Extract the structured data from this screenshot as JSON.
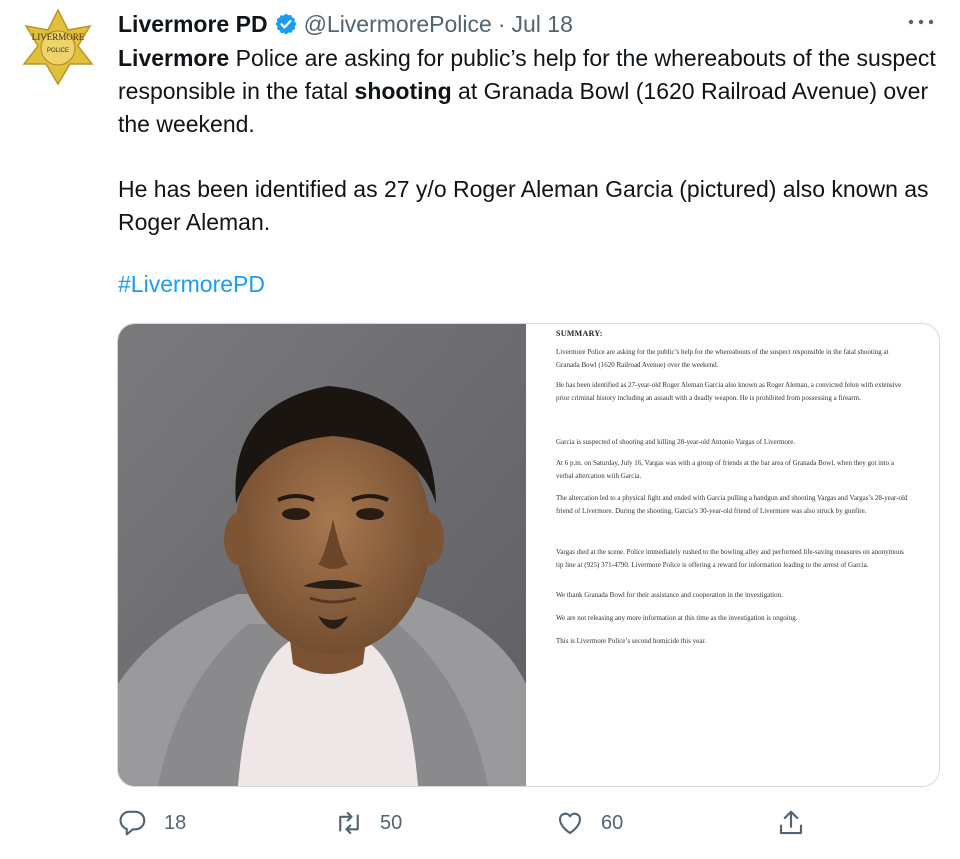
{
  "author": {
    "name": "Livermore PD",
    "handle": "@LivermorePolice",
    "separator": "·",
    "date": "Jul 18",
    "badge_top": "LIVERMORE",
    "badge_mid": "POLICE",
    "badge_color": "#e2c13a"
  },
  "tweet": {
    "p1_part1_bold": "Livermore",
    "p1_part2": " Police are asking for public’s help for the whereabouts of the suspect responsible in the fatal ",
    "p1_part3_bold": "shooting",
    "p1_part4": " at Granada Bowl (1620 Railroad Avenue) over the weekend.",
    "p2": "He has been identified as 27 y/o Roger Aleman Garcia (pictured) also known as Roger Aleman.",
    "hashtag": "#LivermorePD"
  },
  "document": {
    "heading": "SUMMARY:",
    "paragraphs": [
      "Livermore Police are asking for the public’s help for the whereabouts of the suspect responsible in the fatal shooting at Granada Bowl (1620 Railroad Avenue) over the weekend.",
      "He has been identified as 27-year-old Roger Aleman Garcia also known as Roger Aleman, a convicted felon with extensive prior criminal history including an assault with a deadly weapon. He is prohibited from possessing a firearm.",
      "Garcia is suspected of shooting and killing 28-year-old Antonio Vargas of Livermore.",
      "At 6 p.m. on Saturday, July 16, Vargas was with a group of friends at the bar area of Granada Bowl, when they got into a verbal altercation with Garcia.",
      "The altercation led to a physical fight and ended with Garcia pulling a handgun and shooting Vargas and Vargas’s 28-year-old friend of Livermore. During the shooting, Garcia’s 30-year-old friend of Livermore was also struck by gunfire.",
      "Vargas died at the scene. Police immediately rushed to the bowling alley and performed life-saving measures on anonymous tip line at (925) 371-4790. Livermore Police is offering a reward for information leading to the arrest of Garcia.",
      "We thank Granada Bowl for their assistance and cooperation in the investigation.",
      "We are not releasing any more information at this time as the investigation is ongoing.",
      "This is Livermore Police’s second homicide this year."
    ]
  },
  "actions": {
    "replies": "18",
    "retweets": "50",
    "likes": "60",
    "reply_icon": "reply-icon",
    "retweet_icon": "retweet-icon",
    "like_icon": "heart-icon",
    "share_icon": "share-icon"
  },
  "colors": {
    "link": "#1d9bf0",
    "muted": "#536471",
    "text": "#0f1419"
  }
}
